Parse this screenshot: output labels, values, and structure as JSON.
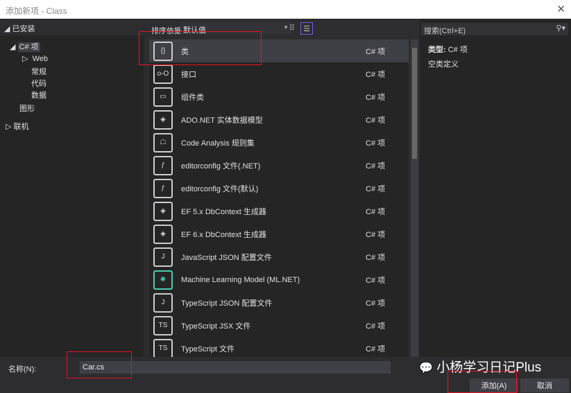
{
  "window": {
    "title": "添加新项 - Class",
    "close": "✕"
  },
  "left": {
    "header": "已安装",
    "tree": [
      {
        "label": "C# 项",
        "arrow": "◢"
      },
      {
        "label": "Web",
        "arrow": "▷"
      },
      {
        "label": "常规"
      },
      {
        "label": "代码"
      },
      {
        "label": "数据"
      },
      {
        "label": "图形"
      },
      {
        "label": "联机",
        "arrow": "▷"
      }
    ]
  },
  "toolbar": {
    "sort_label": "排序依据:",
    "sort_value": "默认值"
  },
  "items": [
    {
      "name": "类",
      "cat": "C# 项",
      "icon": "class-icon"
    },
    {
      "name": "接口",
      "cat": "C# 项",
      "icon": "interface-icon"
    },
    {
      "name": "组件类",
      "cat": "C# 项",
      "icon": "component-icon"
    },
    {
      "name": "ADO.NET 实体数据模型",
      "cat": "C# 项",
      "icon": "entity-model-icon"
    },
    {
      "name": "Code Analysis 规则集",
      "cat": "C# 项",
      "icon": "ruleset-icon"
    },
    {
      "name": "editorconfig 文件(.NET)",
      "cat": "C# 项",
      "icon": "editorconfig-icon"
    },
    {
      "name": "editorconfig 文件(默认)",
      "cat": "C# 项",
      "icon": "editorconfig-icon"
    },
    {
      "name": "EF 5.x DbContext 生成器",
      "cat": "C# 项",
      "icon": "dbcontext-icon"
    },
    {
      "name": "EF 6.x DbContext 生成器",
      "cat": "C# 项",
      "icon": "dbcontext-icon"
    },
    {
      "name": "JavaScript JSON 配置文件",
      "cat": "C# 项",
      "icon": "json-icon"
    },
    {
      "name": "Machine Learning Model (ML.NET)",
      "cat": "C# 项",
      "icon": "ml-icon"
    },
    {
      "name": "TypeScript JSON 配置文件",
      "cat": "C# 项",
      "icon": "json-icon"
    },
    {
      "name": "TypeScript JSX 文件",
      "cat": "C# 项",
      "icon": "ts-file-icon"
    },
    {
      "name": "TypeScript 文件",
      "cat": "C# 项",
      "icon": "ts-file-icon"
    }
  ],
  "right": {
    "search_placeholder": "搜索(Ctrl+E)",
    "type_label": "类型:",
    "type_value": "C# 项",
    "description": "空类定义"
  },
  "bottom": {
    "name_label": "名称(N):",
    "name_value": "Car.cs",
    "add": "添加(A)",
    "cancel": "取消",
    "watermark": "小杨学习日记Plus"
  }
}
